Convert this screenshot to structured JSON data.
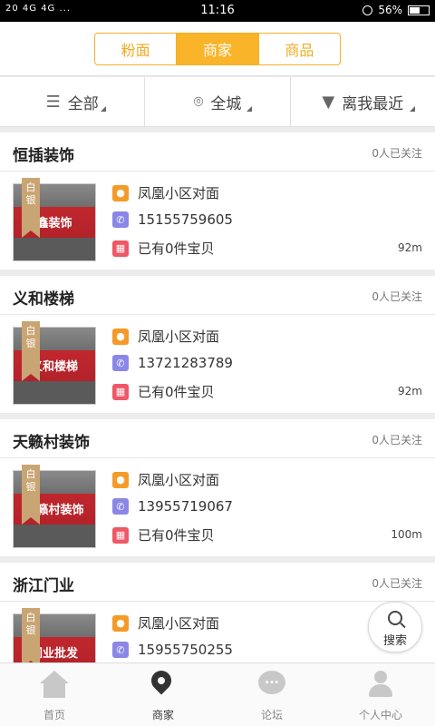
{
  "status": {
    "left": "20 4G 4G ...",
    "time": "11:16",
    "battery": "56%",
    "battery_level": 0.56
  },
  "segments": {
    "items": [
      "粉面",
      "商家",
      "商品"
    ],
    "active": "商家"
  },
  "filters": {
    "category": "全部",
    "area": "全城",
    "sort": "离我最近"
  },
  "shops": [
    {
      "name": "恒插装饰",
      "followers": "0人已关注",
      "badge": "白银",
      "sign": "鑫装饰",
      "address": "凤凰小区对面",
      "phone": "15155759605",
      "items": "已有0件宝贝",
      "distance": "92m"
    },
    {
      "name": "义和楼梯",
      "followers": "0人已关注",
      "badge": "白银",
      "sign": "义和楼梯",
      "address": "凤凰小区对面",
      "phone": "13721283789",
      "items": "已有0件宝贝",
      "distance": "92m"
    },
    {
      "name": "天籁村装饰",
      "followers": "0人已关注",
      "badge": "白银",
      "sign": "天籁村装饰",
      "address": "凤凰小区对面",
      "phone": "13955719067",
      "items": "已有0件宝贝",
      "distance": "100m"
    },
    {
      "name": "浙江门业",
      "followers": "0人已关注",
      "badge": "白银",
      "sign": "门业批发",
      "address": "凤凰小区对面",
      "phone": "15955750255",
      "items": "",
      "distance": ""
    }
  ],
  "search_fab": {
    "label": "搜索"
  },
  "bottom_nav": {
    "items": [
      {
        "label": "首页",
        "icon": "home-icon"
      },
      {
        "label": "商家",
        "icon": "location-pin-icon"
      },
      {
        "label": "论坛",
        "icon": "forum-icon"
      },
      {
        "label": "个人中心",
        "icon": "user-icon"
      }
    ],
    "active": "商家"
  },
  "colors": {
    "accent": "#f9b42a",
    "location": "#f49a28",
    "phone": "#8b87e6",
    "calendar": "#ee5766"
  }
}
